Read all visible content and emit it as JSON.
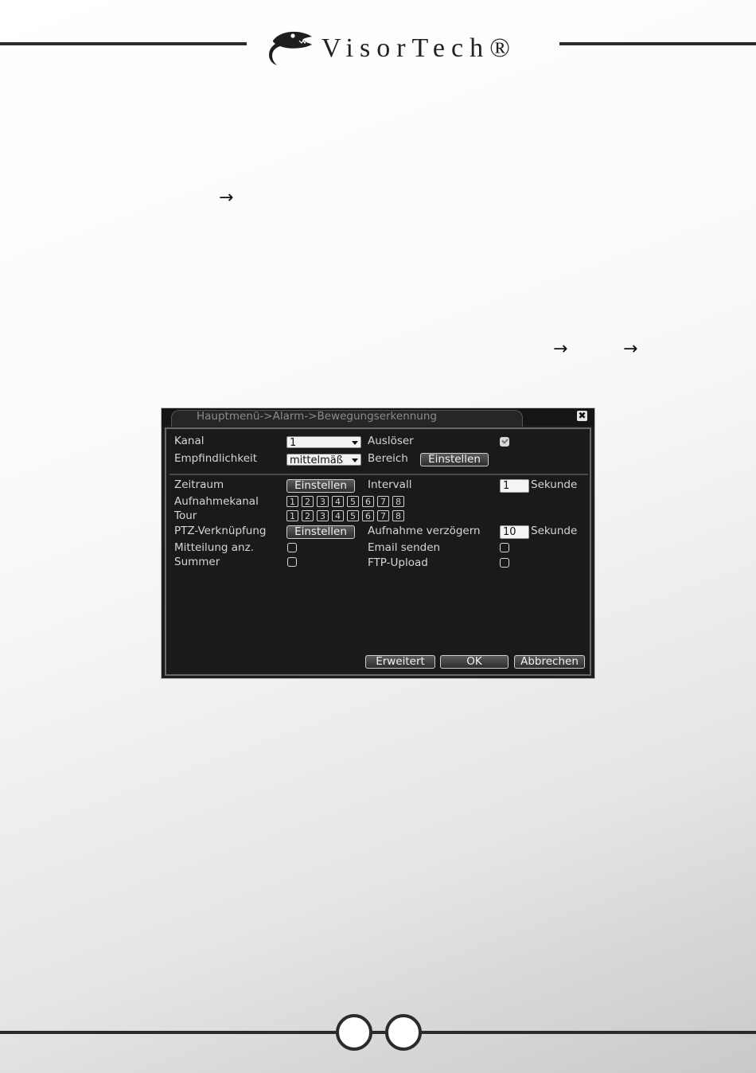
{
  "header": {
    "brand": "VisorTech®"
  },
  "dialog": {
    "title": "Hauptmenü->Alarm->Bewegungserkennung",
    "close_glyph": "✖",
    "kanal": {
      "label": "Kanal",
      "value": "1"
    },
    "ausloeser": {
      "label": "Auslöser",
      "checked": true
    },
    "empfindlichkeit": {
      "label": "Empfindlichkeit",
      "value": "mittelmäß"
    },
    "bereich": {
      "label": "Bereich",
      "button": "Einstellen"
    },
    "zeitraum": {
      "label": "Zeitraum",
      "button": "Einstellen"
    },
    "intervall": {
      "label": "Intervall",
      "value": "1",
      "unit": "Sekunde"
    },
    "aufnahmekanal": {
      "label": "Aufnahmekanal",
      "channels": [
        "1",
        "2",
        "3",
        "4",
        "5",
        "6",
        "7",
        "8"
      ]
    },
    "tour": {
      "label": "Tour",
      "channels": [
        "1",
        "2",
        "3",
        "4",
        "5",
        "6",
        "7",
        "8"
      ]
    },
    "ptz": {
      "label": "PTZ-Verknüpfung",
      "button": "Einstellen"
    },
    "aufnahme_verzoegern": {
      "label": "Aufnahme verzögern",
      "value": "10",
      "unit": "Sekunde"
    },
    "mitteilung": {
      "label": "Mitteilung anz.",
      "checked": false
    },
    "email": {
      "label": "Email senden",
      "checked": false
    },
    "summer": {
      "label": "Summer",
      "checked": false
    },
    "ftp": {
      "label": "FTP-Upload",
      "checked": false
    },
    "buttons": {
      "erweitert": "Erweitert",
      "ok": "OK",
      "abbrechen": "Abbrechen"
    }
  },
  "icons": {
    "arrow": "→",
    "brand_logo": "lizard-logo-icon"
  },
  "colors": {
    "rule": "#2b2b2b",
    "dialog_bg": "#1c1c1c"
  }
}
